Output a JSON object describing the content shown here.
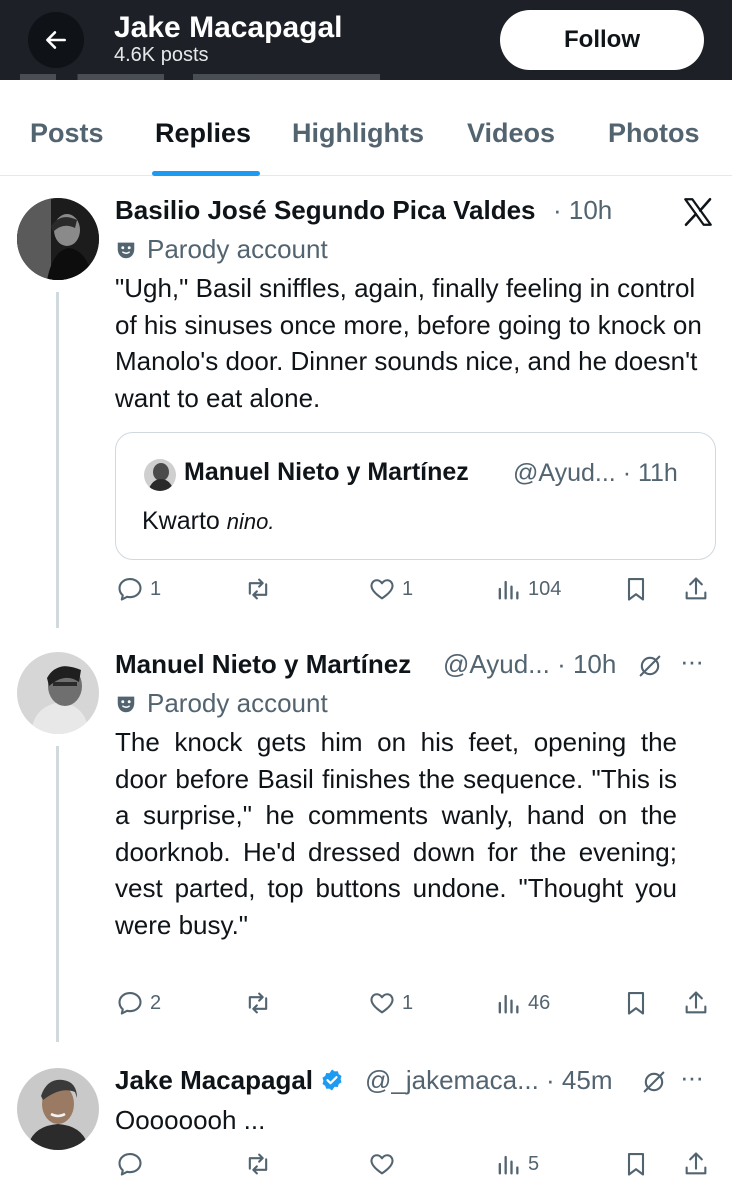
{
  "header": {
    "title": "Jake Macapagal",
    "posts_count": "4.6K posts",
    "follow_label": "Follow"
  },
  "tabs": [
    {
      "label": "Posts"
    },
    {
      "label": "Replies"
    },
    {
      "label": "Highlights"
    },
    {
      "label": "Videos"
    },
    {
      "label": "Photos"
    }
  ],
  "active_tab": "Replies",
  "posts": [
    {
      "author": "Basilio José Segundo Pica Valdes",
      "meta": "· 10h",
      "parody_label": "Parody account",
      "text": "\"Ugh,\" Basil sniffles, again, finally feeling in control of his sinuses once more, before going to knock on Manolo's door. Dinner sounds nice, and he doesn't want to eat alone.",
      "quote": {
        "author": "Manuel Nieto y Martínez",
        "meta": "@Ayud... · 11h",
        "text": "Kwarto",
        "text_italic": "nino."
      },
      "actions": {
        "replies": "1",
        "reposts": "",
        "likes": "1",
        "views": "104"
      }
    },
    {
      "author": "Manuel Nieto y Martínez",
      "meta": "@Ayud... · 10h",
      "parody_label": "Parody account",
      "text": "The knock gets him on his feet, opening the door before Basil finishes the sequence. \"This is a surprise,\" he comments wanly, hand on the doorknob. He'd dressed down for the evening; vest parted, top buttons undone. \"Thought you were busy.\"",
      "actions": {
        "replies": "2",
        "reposts": "",
        "likes": "1",
        "views": "46"
      }
    },
    {
      "author": "Jake Macapagal",
      "meta": "@_jakemaca... · 45m",
      "text": "Oooooooh ...",
      "actions": {
        "replies": "",
        "reposts": "",
        "likes": "",
        "views": "5"
      }
    }
  ],
  "colors": {
    "accent": "#1d9bf0",
    "header_bg": "#1d2127",
    "muted": "#536471"
  }
}
